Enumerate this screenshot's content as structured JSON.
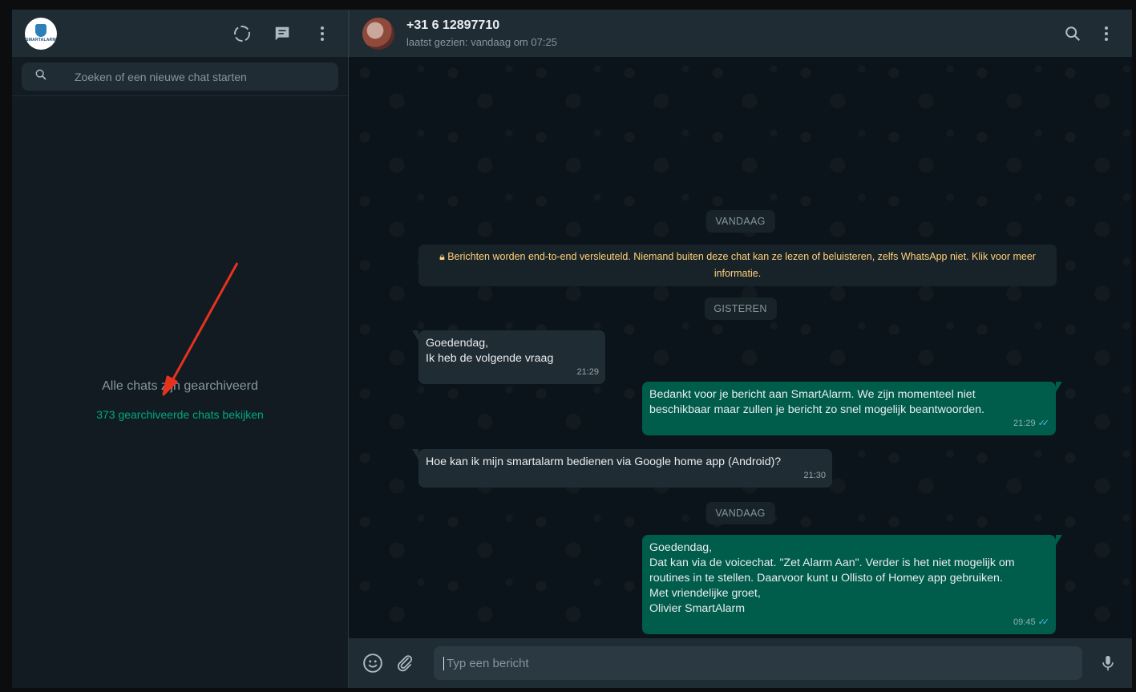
{
  "sidebar": {
    "avatar_brand": "SMARTALARM",
    "icons": [
      "status-icon",
      "new-chat-icon",
      "menu-icon"
    ],
    "search_placeholder": "Zoeken of een nieuwe chat starten",
    "empty_title": "Alle chats zijn gearchiveerd",
    "archived_link": "373 gearchiveerde chats bekijken"
  },
  "chat": {
    "contact_name": "+31 6 12897710",
    "contact_status": "laatst gezien: vandaag om 07:25",
    "chips": [
      "VANDAAG",
      "GISTEREN",
      "VANDAAG"
    ],
    "encryption_notice": "Berichten worden end-to-end versleuteld. Niemand buiten deze chat kan ze lezen of beluisteren, zelfs WhatsApp niet. Klik voor meer informatie.",
    "messages": [
      {
        "direction": "in",
        "lines": [
          "Goedendag,",
          "Ik heb de volgende vraag"
        ],
        "time": "21:29"
      },
      {
        "direction": "out",
        "lines": [
          "Bedankt voor je bericht aan SmartAlarm. We zijn momenteel niet",
          "beschikbaar maar zullen je bericht zo snel mogelijk beantwoorden."
        ],
        "time": "21:29",
        "read": true
      },
      {
        "direction": "in",
        "lines": [
          "Hoe kan ik mijn smartalarm bedienen via Google home app (Android)?"
        ],
        "time": "21:30"
      },
      {
        "direction": "out",
        "lines": [
          "Goedendag,",
          "Dat kan via de voicechat. \"Zet Alarm Aan\". Verder is het niet mogelijk om",
          "routines in te stellen. Daarvoor kunt u Ollisto of Homey app gebruiken.",
          "Met vriendelijke groet,",
          "Olivier SmartAlarm"
        ],
        "time": "09:45",
        "read": true
      }
    ],
    "composer_placeholder": "Typ een bericht"
  },
  "colors": {
    "accent": "#00a884",
    "outgoing_bubble": "#005c4b",
    "incoming_bubble": "#202c33",
    "annotation_arrow": "#e8321e"
  }
}
